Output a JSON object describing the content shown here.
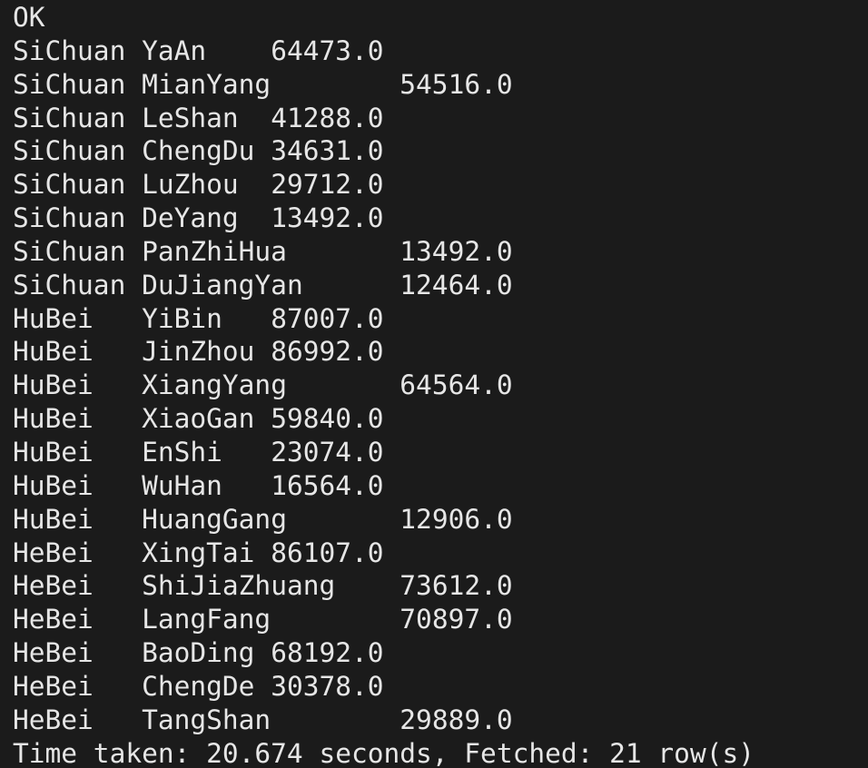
{
  "terminal": {
    "status": "OK",
    "rows": [
      {
        "province": "SiChuan",
        "city": "YaAn",
        "value": "64473.0"
      },
      {
        "province": "SiChuan",
        "city": "MianYang",
        "value": "54516.0"
      },
      {
        "province": "SiChuan",
        "city": "LeShan",
        "value": "41288.0"
      },
      {
        "province": "SiChuan",
        "city": "ChengDu",
        "value": "34631.0"
      },
      {
        "province": "SiChuan",
        "city": "LuZhou",
        "value": "29712.0"
      },
      {
        "province": "SiChuan",
        "city": "DeYang",
        "value": "13492.0"
      },
      {
        "province": "SiChuan",
        "city": "PanZhiHua",
        "value": "13492.0"
      },
      {
        "province": "SiChuan",
        "city": "DuJiangYan",
        "value": "12464.0"
      },
      {
        "province": "HuBei",
        "city": "YiBin",
        "value": "87007.0"
      },
      {
        "province": "HuBei",
        "city": "JinZhou",
        "value": "86992.0"
      },
      {
        "province": "HuBei",
        "city": "XiangYang",
        "value": "64564.0"
      },
      {
        "province": "HuBei",
        "city": "XiaoGan",
        "value": "59840.0"
      },
      {
        "province": "HuBei",
        "city": "EnShi",
        "value": "23074.0"
      },
      {
        "province": "HuBei",
        "city": "WuHan",
        "value": "16564.0"
      },
      {
        "province": "HuBei",
        "city": "HuangGang",
        "value": "12906.0"
      },
      {
        "province": "HeBei",
        "city": "XingTai",
        "value": "86107.0"
      },
      {
        "province": "HeBei",
        "city": "ShiJiaZhuang",
        "value": "73612.0"
      },
      {
        "province": "HeBei",
        "city": "LangFang",
        "value": "70897.0"
      },
      {
        "province": "HeBei",
        "city": "BaoDing",
        "value": "68192.0"
      },
      {
        "province": "HeBei",
        "city": "ChengDe",
        "value": "30378.0"
      },
      {
        "province": "HeBei",
        "city": "TangShan",
        "value": "29889.0"
      }
    ],
    "footer": "Time taken: 20.674 seconds, Fetched: 21 row(s)"
  },
  "colors": {
    "background": "#1b1b1b",
    "text": "#e6e6e6"
  }
}
